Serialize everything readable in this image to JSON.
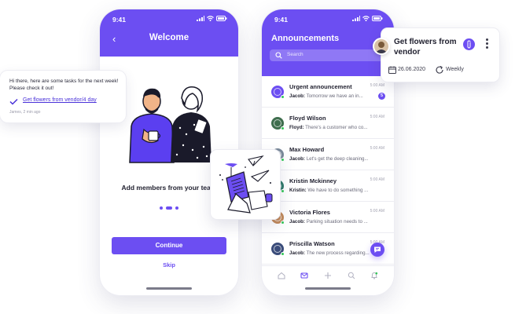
{
  "colors": {
    "accent": "#6c4ef2",
    "online": "#34c759",
    "link": "#4a32d9"
  },
  "phone_onboarding": {
    "status_time": "9:41",
    "title": "Welcome",
    "subtitle": "Add members from your team",
    "continue_label": "Continue",
    "skip_label": "Skip"
  },
  "phone_announcements": {
    "status_time": "9:41",
    "title": "Announcements",
    "search_placeholder": "Search",
    "items": [
      {
        "name": "Urgent announcement",
        "time": "5:00 AM",
        "sender": "Jacob:",
        "message": "Tomorrow we have an in...",
        "badge": "5"
      },
      {
        "name": "Floyd Wilson",
        "time": "5:00 AM",
        "sender": "Floyd:",
        "message": "There's a customer who co...",
        "badge": ""
      },
      {
        "name": "Max Howard",
        "time": "5:00 AM",
        "sender": "Jacob:",
        "message": "Let's get the deep cleaning...",
        "badge": ""
      },
      {
        "name": "Kristin Mckinney",
        "time": "5:00 AM",
        "sender": "Kristin:",
        "message": "We have to do something ...",
        "badge": ""
      },
      {
        "name": "Victoria Flores",
        "time": "5:00 AM",
        "sender": "Jacob:",
        "message": "Parking situation needs to ...",
        "badge": ""
      },
      {
        "name": "Priscilla Watson",
        "time": "5:00 AM",
        "sender": "Jacob:",
        "message": "The new process regarding...",
        "badge": ""
      }
    ]
  },
  "chat_bubble": {
    "text": "Hi there, here are some tasks for the next week! Please check it out!",
    "link": "Get flowers from vendor/4 day",
    "meta": "James, 2 min ago"
  },
  "task_card": {
    "title": "Get flowers from vendor",
    "date": "26.06.2020",
    "repeat": "Weekly"
  }
}
